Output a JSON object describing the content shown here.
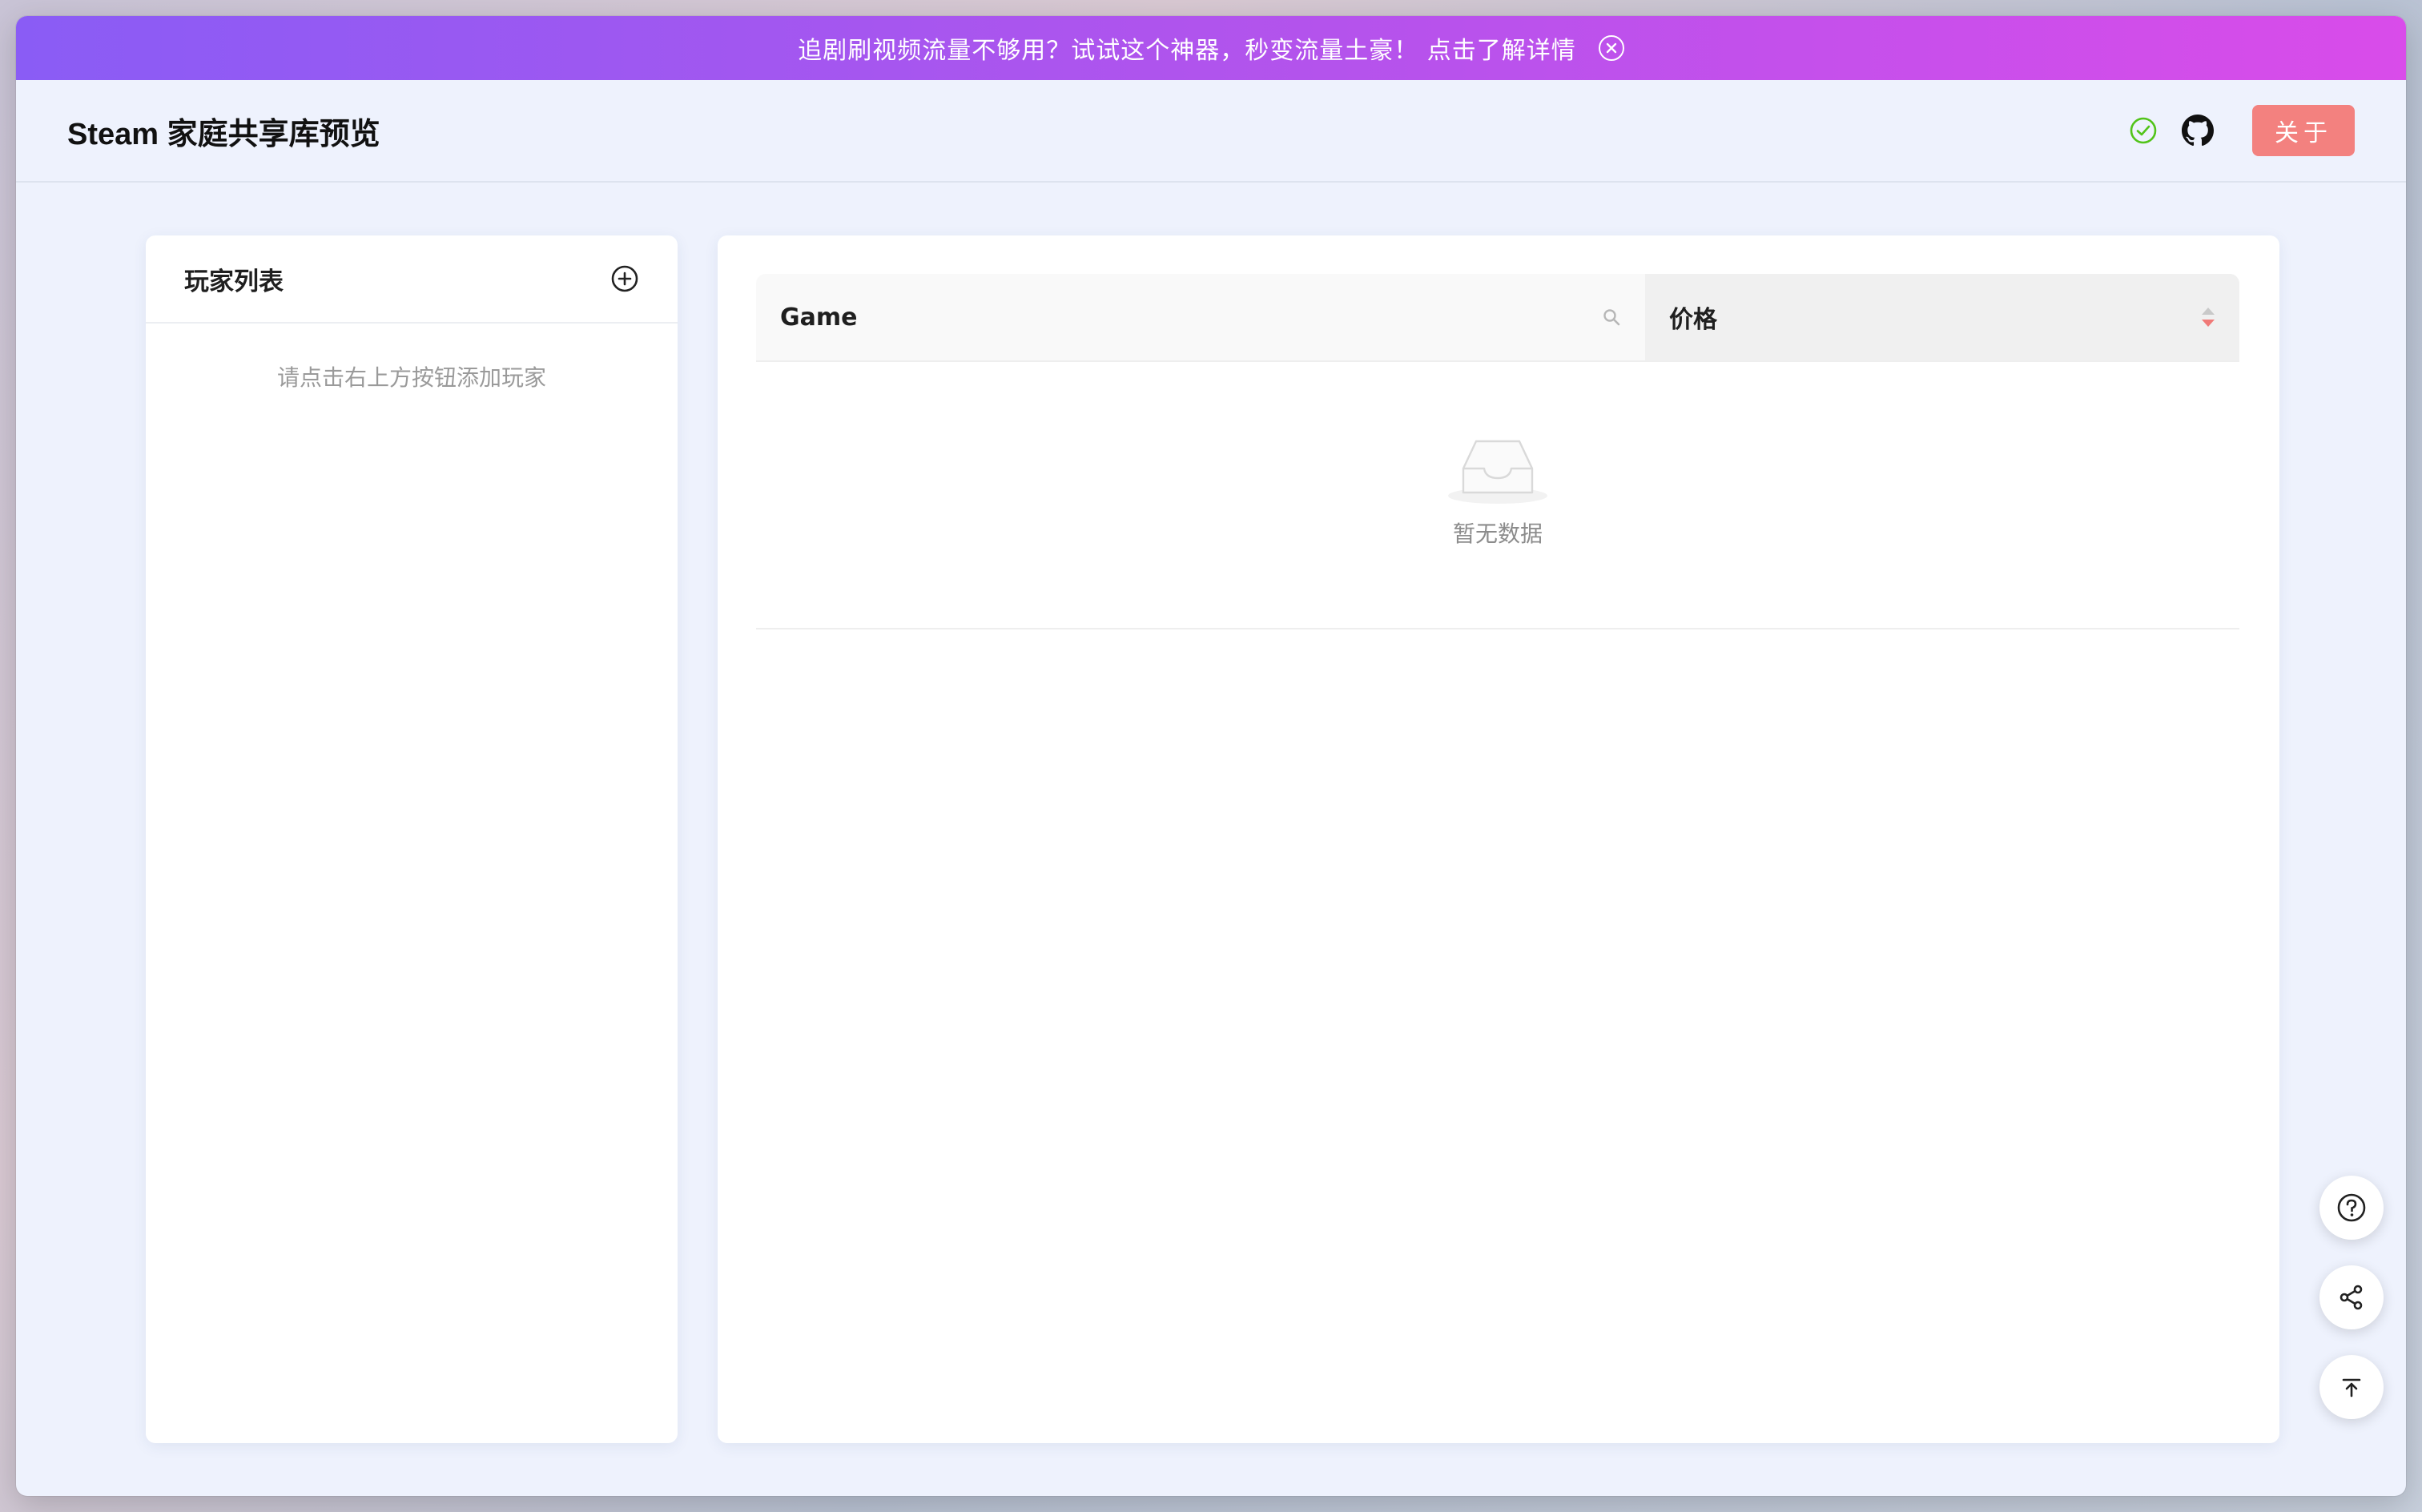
{
  "banner": {
    "text": "追剧刷视频流量不够用？试试这个神器，秒变流量土豪！ 点击了解详情",
    "close_icon": "close-circle-icon"
  },
  "header": {
    "title": "Steam 家庭共享库预览",
    "status_icon": "check-circle-icon",
    "status_color": "#52c41a",
    "github_icon": "github-icon",
    "about_label": "关于",
    "about_color": "#f3817f"
  },
  "players": {
    "title": "玩家列表",
    "add_icon": "plus-circle-icon",
    "empty_text": "请点击右上方按钮添加玩家"
  },
  "games_table": {
    "columns": [
      "Game",
      "价格"
    ],
    "search_icon": "search-icon",
    "sort_icon": "sort-icon",
    "empty_icon": "inbox-icon",
    "empty_text": "暂无数据"
  },
  "float_buttons": [
    "help-icon",
    "share-icon",
    "back-to-top-icon"
  ],
  "accent_gradient": [
    "#8a5cf5",
    "#d94cea"
  ]
}
